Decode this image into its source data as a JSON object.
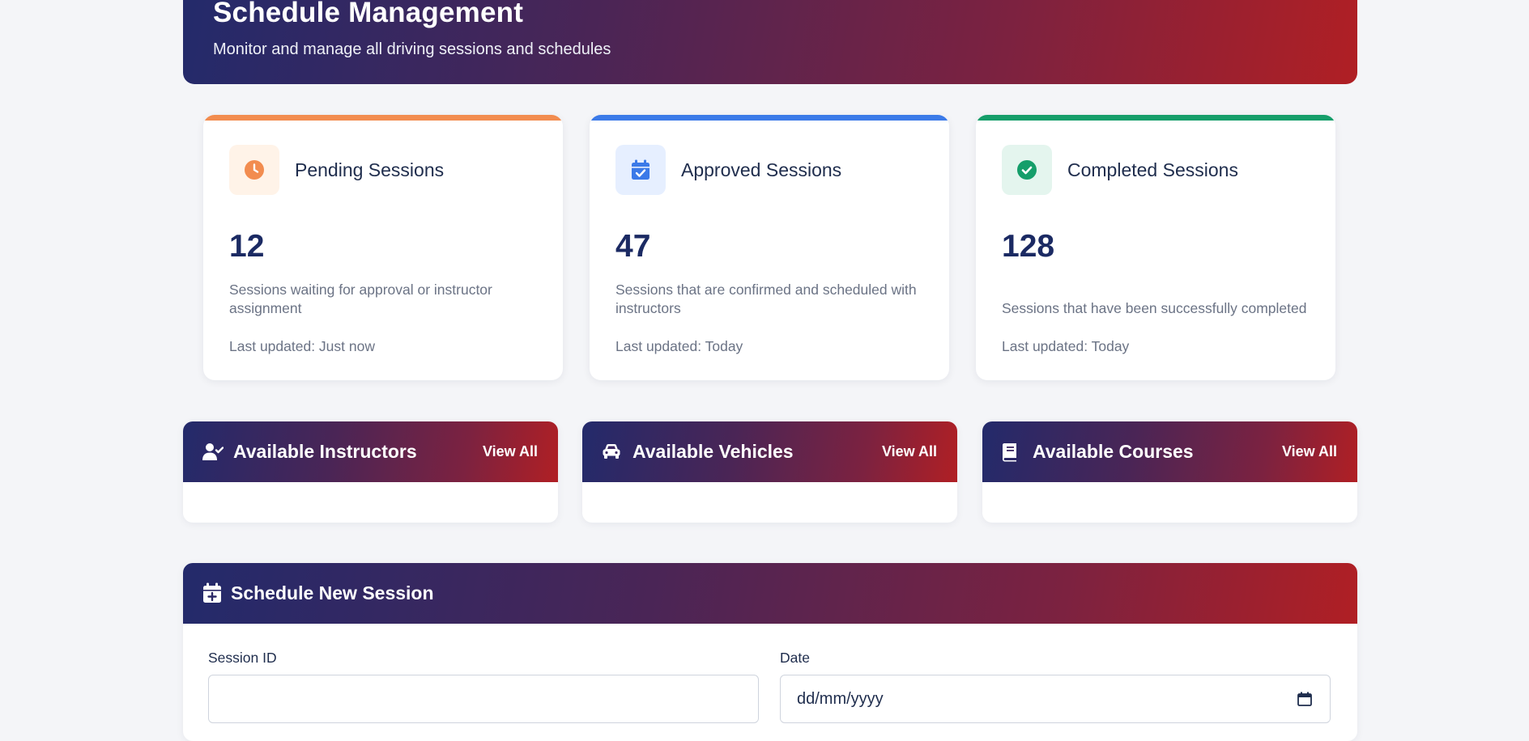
{
  "header": {
    "title": "Schedule Management",
    "subtitle": "Monitor and manage all driving sessions and schedules"
  },
  "stats": [
    {
      "title": "Pending Sessions",
      "value": "12",
      "description": "Sessions waiting for approval or instructor assignment",
      "updated": "Last updated: Just now",
      "accent": "#f28c4f",
      "icon": "clock-icon"
    },
    {
      "title": "Approved Sessions",
      "value": "47",
      "description": "Sessions that are confirmed and scheduled with instructors",
      "updated": "Last updated: Today",
      "accent": "#3b7ae8",
      "icon": "calendar-check-icon"
    },
    {
      "title": "Completed Sessions",
      "value": "128",
      "description": "Sessions that have been successfully completed",
      "updated": "Last updated: Today",
      "accent": "#159e6a",
      "icon": "check-circle-icon"
    }
  ],
  "resources": [
    {
      "title": "Available Instructors",
      "action": "View All",
      "icon": "user-check-icon"
    },
    {
      "title": "Available Vehicles",
      "action": "View All",
      "icon": "car-icon"
    },
    {
      "title": "Available Courses",
      "action": "View All",
      "icon": "book-icon"
    }
  ],
  "form": {
    "title": "Schedule New Session",
    "icon": "calendar-plus-icon",
    "fields": [
      {
        "label": "Session ID",
        "value": "",
        "placeholder": ""
      },
      {
        "label": "Date",
        "value": "dd/mm/yyyy"
      }
    ]
  },
  "colors": {
    "gradient_start": "#232a6b",
    "gradient_end": "#b01f24",
    "heading_value": "#1b2a63"
  }
}
